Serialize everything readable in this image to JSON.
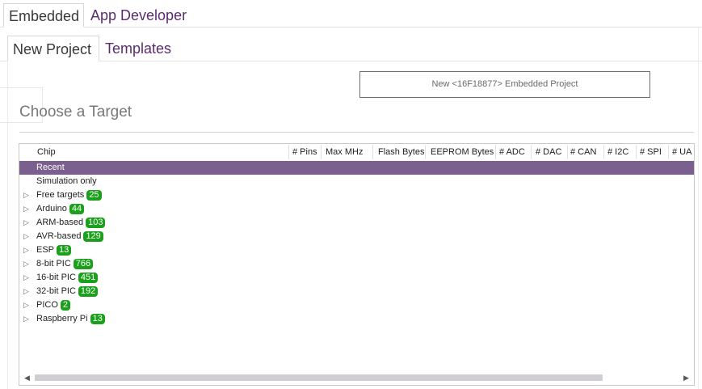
{
  "top_tabs": [
    {
      "label": "Embedded",
      "active": true
    },
    {
      "label": "App Developer",
      "active": false
    }
  ],
  "sub_tabs": [
    {
      "label": "New Project",
      "active": true
    },
    {
      "label": "Templates",
      "active": false
    }
  ],
  "new_project_button": "New <16F18877> Embedded Project",
  "section_title": "Choose a Target",
  "columns": [
    "Chip",
    "# Pins",
    "Max MHz",
    "Flash Bytes",
    "EEPROM Bytes",
    "# ADC",
    "# DAC",
    "# CAN",
    "# I2C",
    "# SPI",
    "# UA"
  ],
  "rows": [
    {
      "label": "Recent",
      "expander": true,
      "selected": true
    },
    {
      "label": "Simulation only",
      "expander": false
    },
    {
      "label": "Free targets",
      "count": "25",
      "expander": true
    },
    {
      "label": "Arduino",
      "count": "44",
      "expander": true
    },
    {
      "label": "ARM-based",
      "count": "103",
      "expander": true
    },
    {
      "label": "AVR-based",
      "count": "129",
      "expander": true
    },
    {
      "label": "ESP",
      "count": "13",
      "expander": true
    },
    {
      "label": "8-bit PIC",
      "count": "766",
      "expander": true
    },
    {
      "label": "16-bit PIC",
      "count": "451",
      "expander": true
    },
    {
      "label": "32-bit PIC",
      "count": "192",
      "expander": true
    },
    {
      "label": "PICO",
      "count": "2",
      "expander": true
    },
    {
      "label": "Raspberry Pi",
      "count": "13",
      "expander": true
    }
  ],
  "colors": {
    "selected_row": "#7b5f8f",
    "badge": "#1aa01a",
    "accent_text": "#5a2b6e"
  },
  "icons": {
    "expander": "triangle-right-icon",
    "scroll_left": "arrow-left-icon",
    "scroll_right": "arrow-right-icon"
  }
}
